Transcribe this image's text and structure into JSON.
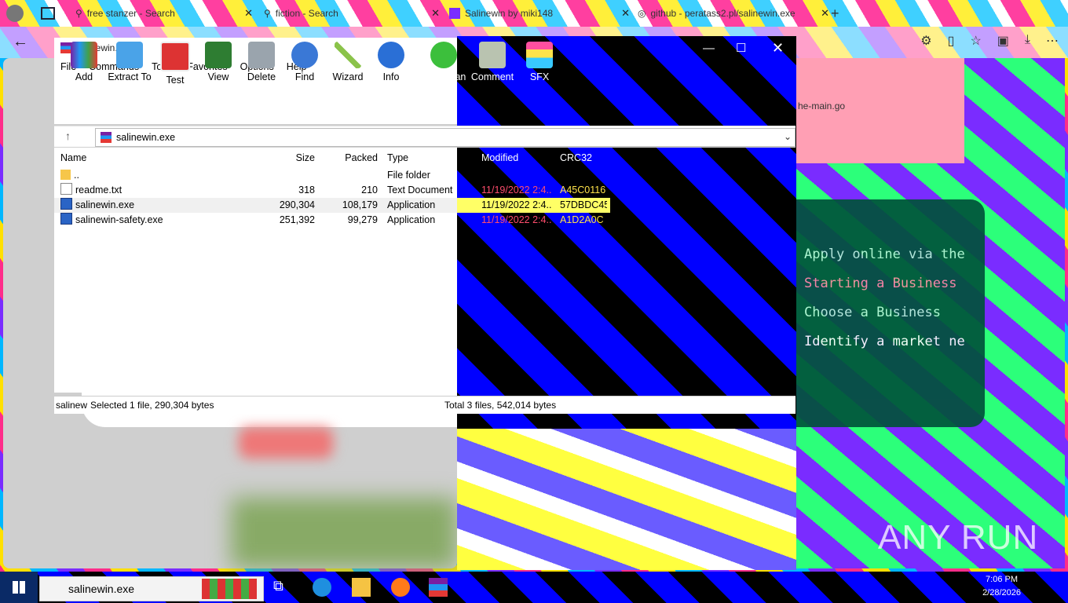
{
  "browser": {
    "tabs": [
      {
        "label": "free stanzer - Search"
      },
      {
        "label": "fiction - Search"
      },
      {
        "label": "Salinewin by miki148"
      },
      {
        "label": "github - peratass2.pl/salinewin.exe"
      }
    ],
    "page_text": {
      "top_snippet": "he-main.go",
      "lines": [
        "Apply online via the",
        "Starting a Business",
        "Choose a Business",
        "Identify a market ne"
      ]
    }
  },
  "winrar": {
    "title": "salinewin.exe",
    "menu": [
      "File",
      "Commands",
      "Tools",
      "Favorites",
      "Options",
      "Help"
    ],
    "toolbar": [
      "Add",
      "Extract To",
      "Test",
      "View",
      "Delete",
      "Find",
      "Wizard",
      "Info",
      "VirusScan",
      "Comment",
      "SFX"
    ],
    "path": "salinewin.exe",
    "columns": [
      "Name",
      "Size",
      "Packed",
      "Type",
      "Modified",
      "CRC32"
    ],
    "files": [
      {
        "name": "..",
        "size": "",
        "packed": "",
        "type": "File folder",
        "modified": "",
        "crc": ""
      },
      {
        "name": "readme.txt",
        "size": "318",
        "packed": "210",
        "type": "Text Document",
        "modified": "11/19/2022 2:4...",
        "crc": "A45C0116"
      },
      {
        "name": "salinewin.exe",
        "size": "290,304",
        "packed": "108,179",
        "type": "Application",
        "modified": "11/19/2022 2:4...",
        "crc": "57DBDC45"
      },
      {
        "name": "salinewin-safety.exe",
        "size": "251,392",
        "packed": "99,279",
        "type": "Application",
        "modified": "11/19/2022 2:4...",
        "crc": "A1D2A0C"
      }
    ],
    "status_left_label": "salinew",
    "status_left": "Selected 1 file, 290,304 bytes",
    "status_right": "Total 3 files, 542,014 bytes"
  },
  "taskbar": {
    "search_value": "salinewin.exe",
    "clock_time": "7:06 PM",
    "clock_date": "2/28/2026"
  },
  "watermark": "ANY RUN",
  "colors": {
    "accent_blue": "#0000ff",
    "selection": "#f0f0f0"
  }
}
